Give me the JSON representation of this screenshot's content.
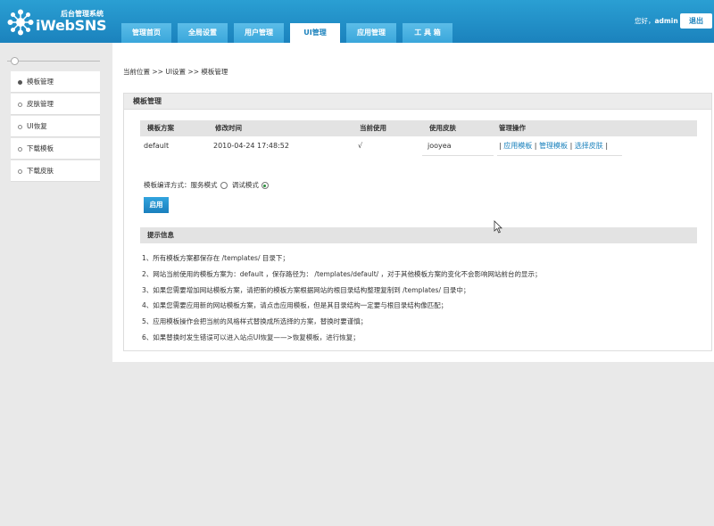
{
  "header": {
    "logo_sub": "后台管理系统",
    "logo_text": "iWebSNS",
    "greeting_prefix": "您好，",
    "username": "admin",
    "logout_label": "退出"
  },
  "nav": {
    "tabs": [
      "管理首页",
      "全局设置",
      "用户管理",
      "UI管理",
      "应用管理",
      "工 具 箱"
    ],
    "active_index": 3
  },
  "sidebar": {
    "items": [
      "模板管理",
      "皮肤管理",
      "UI恢复",
      "下载模板",
      "下载皮肤"
    ],
    "active_index": 0
  },
  "breadcrumb": "当前位置 >> UI设置 >> 模板管理",
  "panel": {
    "title": "模板管理",
    "columns": [
      "模板方案",
      "修改时间",
      "当前使用",
      "使用皮肤",
      "管理操作"
    ],
    "row": {
      "scheme": "default",
      "modified": "2010-04-24 17:48:52",
      "current": "√",
      "skin": "jooyea",
      "actions": [
        "应用模板",
        "管理模板",
        "选择皮肤"
      ]
    },
    "compile_label": "模板编译方式：",
    "compile_options": [
      "服务模式",
      "调试模式"
    ],
    "compile_selected": 1,
    "apply_label": "启用",
    "tips_title": "提示信息",
    "tips": [
      "1、所有模板方案都保存在 /templates/ 目录下；",
      "2、网站当前使用的模板方案为：default ，保存路径为： /templates/default/ ，对于其他模板方案的变化不会影响网站前台的显示；",
      "3、如果您需要增加网站模板方案，请把新的模板方案根据网站的根目录结构整理复制到 /templates/ 目录中；",
      "4、如果您需要应用新的网站模板方案，请点击应用模板，但是其目录结构一定要与根目录结构像匹配；",
      "5、应用模板操作会把当前的风格样式替换成所选择的方案，替换时要谨慎；",
      "6、如果替换时发生错误可以进入站点UI恢复——>恢复模板，进行恢复；"
    ]
  },
  "colors": {
    "header_blue": "#1b82bd",
    "tab_blue": "#3aa6db",
    "link_blue": "#1b82bd",
    "page_bg": "#e9e9e9"
  }
}
